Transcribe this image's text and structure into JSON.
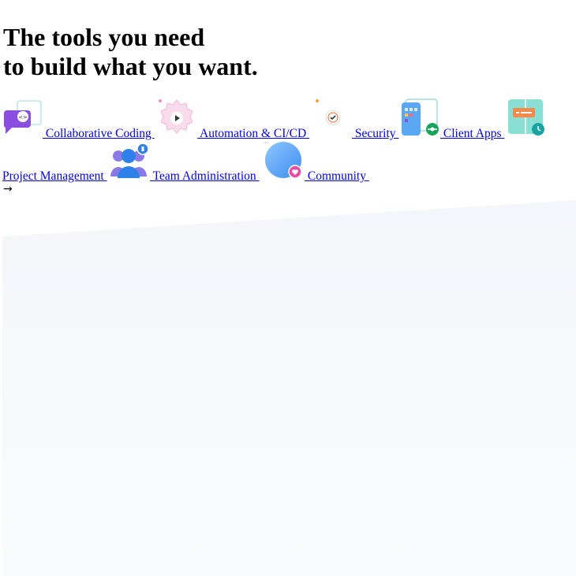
{
  "headline": {
    "line1": "The tools you need",
    "line2": "to build what you want."
  },
  "features": [
    {
      "label": " Collaborative Coding ",
      "icon": "chat-code-icon"
    },
    {
      "label": " Automation & CI/CD ",
      "icon": "gear-play-icon"
    },
    {
      "label": " Security ",
      "icon": "shield-check-icon"
    },
    {
      "label": " Client Apps ",
      "icon": "phone-apps-icon"
    },
    {
      "label": "Project Management ",
      "icon": "board-clock-icon"
    },
    {
      "label": " Team Administration ",
      "icon": "team-users-icon"
    },
    {
      "label": " Community ",
      "icon": "globe-heart-icon"
    }
  ],
  "arrow": "→",
  "colors": {
    "link": "#0000ee",
    "panel": "#f6f8fb",
    "purple": "#8a4fe0",
    "pink": "#f7d6ea",
    "green": "#1aa35a",
    "teal": "#2db6b0"
  }
}
